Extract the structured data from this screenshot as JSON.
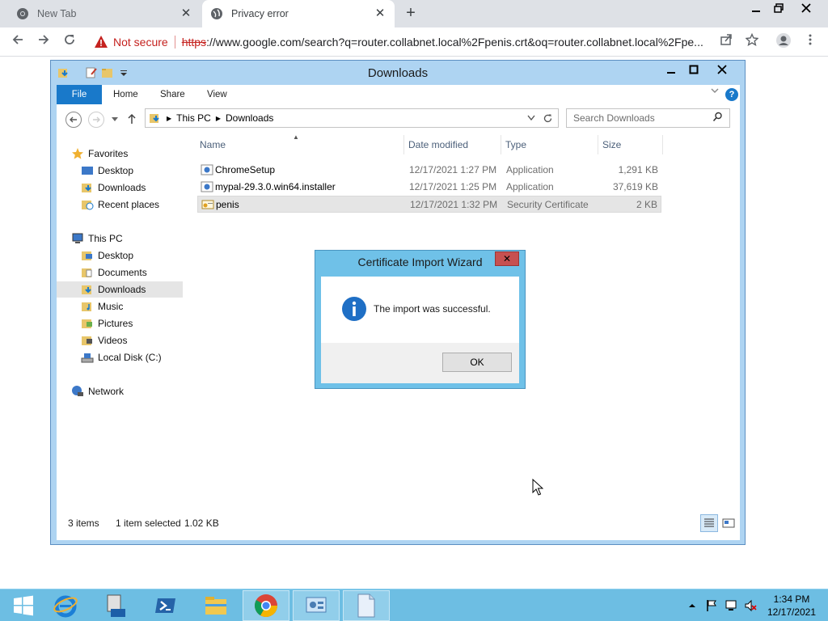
{
  "browser": {
    "tabs": [
      {
        "title": "New Tab",
        "icon": "chrome-icon"
      },
      {
        "title": "Privacy error",
        "icon": "globe-icon"
      }
    ],
    "close_glyph": "✕",
    "new_tab_glyph": "+",
    "security_label": "Not secure",
    "url_scheme": "https",
    "url_rest": "://www.google.com/search?q=router.collabnet.local%2Fpenis.crt&oq=router.collabnet.local%2Fpe..."
  },
  "explorer": {
    "title": "Downloads",
    "ribbon_tabs": [
      "File",
      "Home",
      "Share",
      "View"
    ],
    "help": "?",
    "breadcrumb": [
      "This PC",
      "Downloads"
    ],
    "search_placeholder": "Search Downloads",
    "nav": {
      "favorites_header": "Favorites",
      "favorites": [
        "Desktop",
        "Downloads",
        "Recent places"
      ],
      "thispc_header": "This PC",
      "thispc": [
        "Desktop",
        "Documents",
        "Downloads",
        "Music",
        "Pictures",
        "Videos",
        "Local Disk (C:)"
      ],
      "network": "Network",
      "selected": "Downloads"
    },
    "columns": [
      "Name",
      "Date modified",
      "Type",
      "Size"
    ],
    "files": [
      {
        "name": "ChromeSetup",
        "date": "12/17/2021 1:27 PM",
        "type": "Application",
        "size": "1,291 KB",
        "icon": "installer-icon"
      },
      {
        "name": "mypal-29.3.0.win64.installer",
        "date": "12/17/2021 1:25 PM",
        "type": "Application",
        "size": "37,619 KB",
        "icon": "installer-icon"
      },
      {
        "name": "penis",
        "date": "12/17/2021 1:32 PM",
        "type": "Security Certificate",
        "size": "2 KB",
        "icon": "certificate-icon"
      }
    ],
    "status_items": "3 items",
    "status_selected": "1 item selected",
    "status_size": "1.02 KB"
  },
  "dialog": {
    "title": "Certificate Import Wizard",
    "message": "The import was successful.",
    "ok": "OK",
    "close_glyph": "✕"
  },
  "taskbar": {
    "time": "1:34 PM",
    "date": "12/17/2021"
  },
  "colors": {
    "explorer_frame": "#aed4f2",
    "dialog_frame": "#6fc1e8",
    "taskbar": "#6dbee3",
    "accent": "#1979ca",
    "warning": "#c5221f"
  }
}
